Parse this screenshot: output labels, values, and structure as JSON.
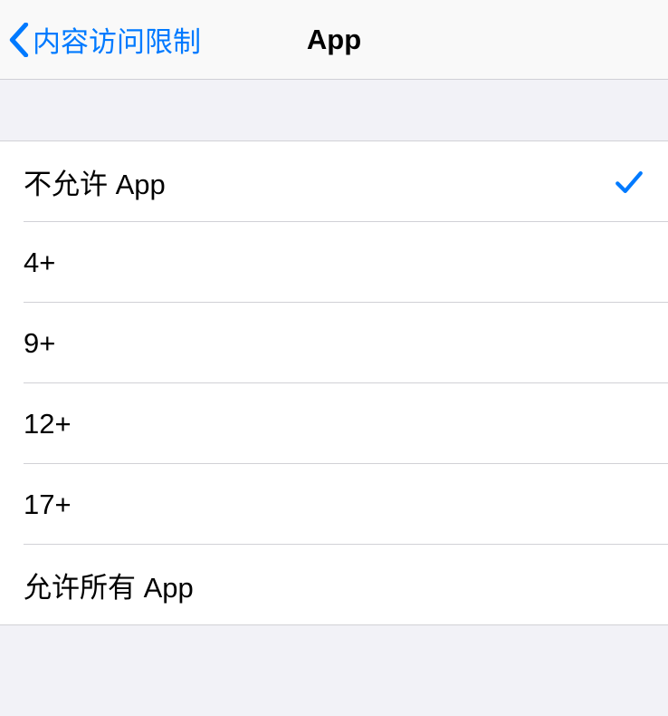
{
  "header": {
    "back_label": "内容访问限制",
    "title": "App"
  },
  "options": [
    {
      "label": "不允许 App",
      "selected": true
    },
    {
      "label": "4+",
      "selected": false
    },
    {
      "label": "9+",
      "selected": false
    },
    {
      "label": "12+",
      "selected": false
    },
    {
      "label": "17+",
      "selected": false
    },
    {
      "label": "允许所有 App",
      "selected": false
    }
  ],
  "colors": {
    "accent": "#007aff"
  }
}
